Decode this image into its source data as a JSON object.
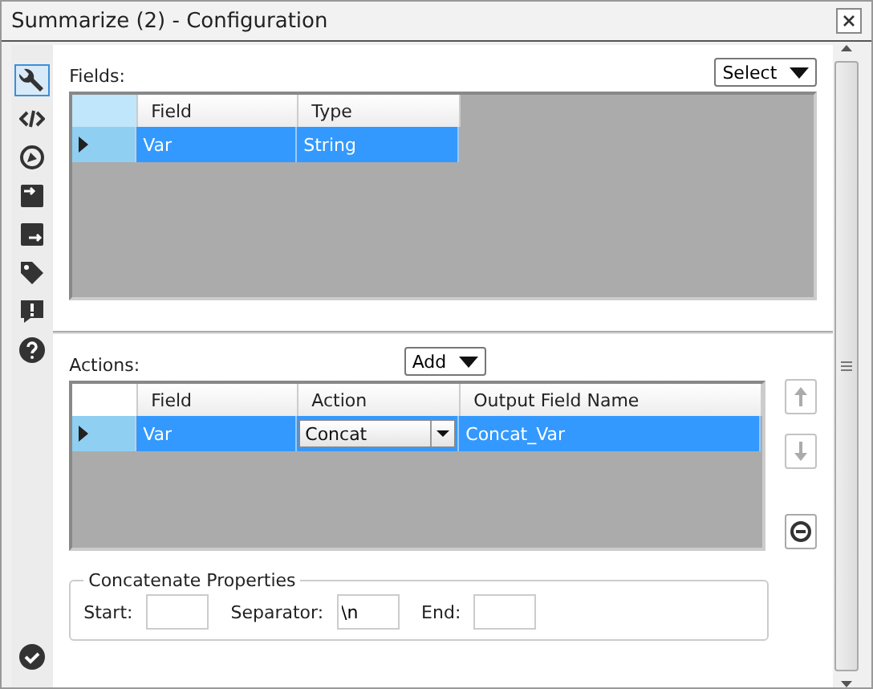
{
  "window": {
    "title": "Summarize (2) - Configuration"
  },
  "toolbar": [
    {
      "kind": "wrench",
      "selected": true
    },
    {
      "kind": "code",
      "selected": false
    },
    {
      "kind": "compass",
      "selected": false
    },
    {
      "kind": "input",
      "selected": false
    },
    {
      "kind": "output",
      "selected": false
    },
    {
      "kind": "tag",
      "selected": false
    },
    {
      "kind": "alert",
      "selected": false
    },
    {
      "kind": "help",
      "selected": false
    }
  ],
  "fields": {
    "label": "Fields:",
    "select_button": "Select",
    "columns": [
      "Field",
      "Type"
    ],
    "rows": [
      {
        "cells": [
          "Var",
          "String"
        ],
        "selected": true
      }
    ]
  },
  "actions": {
    "label": "Actions:",
    "add_button": "Add",
    "columns": [
      "Field",
      "Action",
      "Output Field Name"
    ],
    "rows": [
      {
        "field": "Var",
        "action": "Concat",
        "output": "Concat_Var",
        "selected": true
      }
    ],
    "side_buttons": [
      {
        "kind": "up",
        "disabled": true
      },
      {
        "kind": "down",
        "disabled": true
      },
      {
        "kind": "remove",
        "disabled": false
      }
    ]
  },
  "concatenate": {
    "title": "Concatenate Properties",
    "inputs": [
      {
        "label": "Start:"
      },
      {
        "label": "Separator:",
        "value": "\\n"
      },
      {
        "label": "End:"
      }
    ]
  }
}
